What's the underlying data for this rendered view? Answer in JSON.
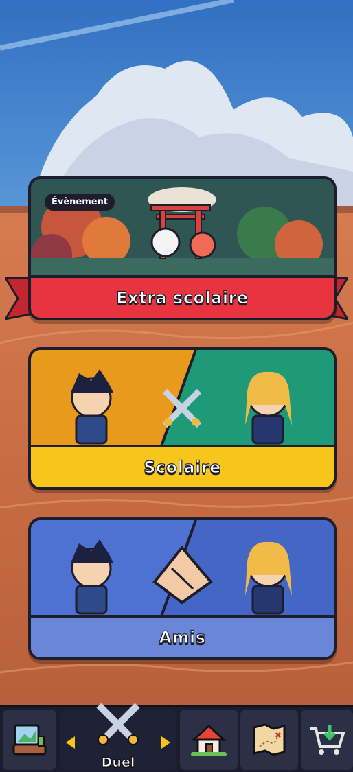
{
  "modes": {
    "event": {
      "badge": "Évènement",
      "title": "Extra scolaire",
      "color": "#e8343f",
      "icon": "torii-gate-mascots-icon"
    },
    "school": {
      "title": "Scolaire",
      "color": "#f7c51b",
      "icon": "crossed-swords-icon"
    },
    "friends": {
      "title": "Amis",
      "color": "#6a86d6",
      "icon": "handshake-icon"
    }
  },
  "nav": {
    "items": [
      {
        "name": "gallery-shop-icon",
        "label": ""
      },
      {
        "name": "duel",
        "label": "Duel"
      },
      {
        "name": "home-icon",
        "label": ""
      },
      {
        "name": "map-icon",
        "label": ""
      },
      {
        "name": "cart-icon",
        "label": ""
      }
    ],
    "active": "Duel",
    "accent": "#f6c51a"
  },
  "colors": {
    "sky": "#3f79c7",
    "ground": "#c86a43",
    "outline": "#1d1d2b"
  }
}
